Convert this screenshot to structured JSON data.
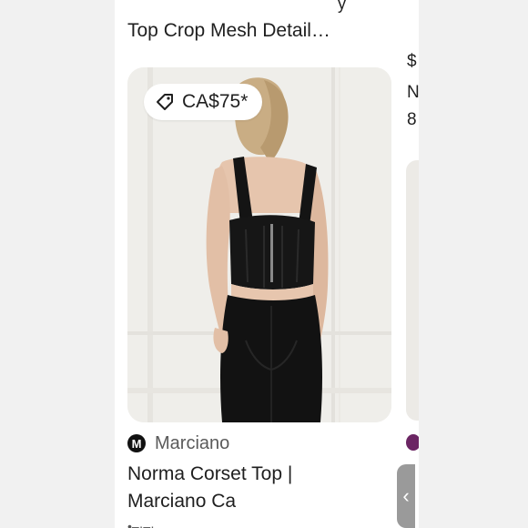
{
  "previous_card": {
    "title": "Top Crop Mesh Detail…"
  },
  "card": {
    "price": "CA$75*",
    "price_icon": "tag-icon",
    "merchant_logo_letter": "M",
    "merchant": "Marciano",
    "title_line1": "Norma Corset Top |",
    "title_line2": "Marciano Ca"
  },
  "next_card": {
    "glyph_1": "$",
    "glyph_2": "N",
    "glyph_3": "8",
    "avatar_color": "#6b2563"
  },
  "back_handle": {
    "icon": "chevron-left-icon",
    "glyph": "‹"
  },
  "colors": {
    "text": "#1f1f1f",
    "muted": "#5a5a5a",
    "page_bg": "#f1f1f1",
    "card_bg": "#ffffff",
    "handle": "#9a9a9a"
  }
}
